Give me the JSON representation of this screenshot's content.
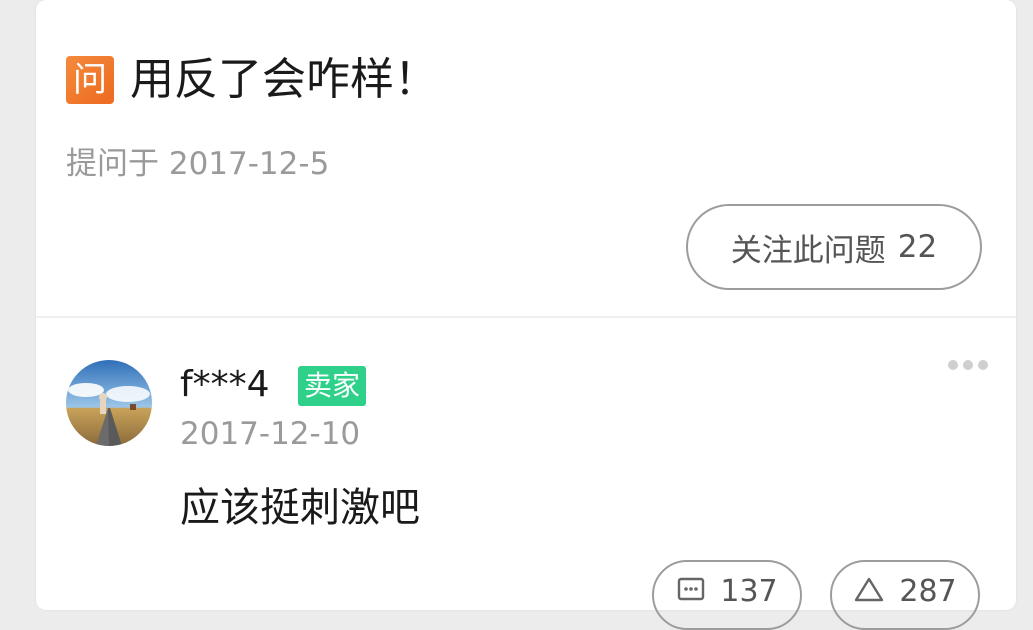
{
  "question": {
    "badge": "问",
    "title": "用反了会咋样！",
    "asked_label": "提问于 2017-12-5",
    "follow_label": "关注此问题",
    "follow_count": "22"
  },
  "answer": {
    "username": "f***4",
    "role_badge": "卖家",
    "date": "2017-12-10",
    "text": "应该挺刺激吧",
    "comment_count": "137",
    "like_count": "287"
  },
  "icons": {
    "more": "more-dots-icon",
    "comment": "comment-icon",
    "like": "thumb-up-triangle-icon"
  },
  "colors": {
    "question_badge": "#ec6a1f",
    "seller_badge": "#2fd08a",
    "muted_text": "#9a9a9a"
  }
}
